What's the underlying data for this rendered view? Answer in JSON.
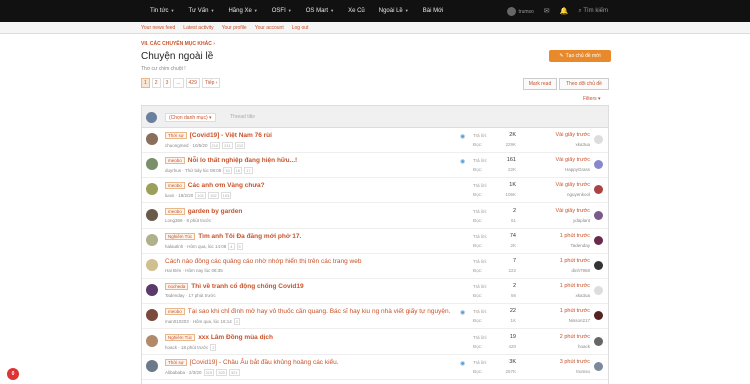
{
  "nav": {
    "items": [
      "Tin tức",
      "Tư Vấn",
      "Hãng Xe",
      "OSFI",
      "OS Mart",
      "Xe Cũ",
      "Ngoài Lề",
      "Bài Mới"
    ],
    "username": "trumso",
    "search_label": "Tìm kiếm"
  },
  "subnav": [
    "Your news feed",
    "Latest activity",
    "Your profile",
    "Your account",
    "Log out"
  ],
  "breadcrumb": "VII. CÁC CHUYÊN MỤC KHÁC",
  "page": {
    "title": "Chuyện ngoài lề",
    "subtitle": "Thơ cư chim chuột !",
    "new_thread_button": "Tạo chủ đề mới",
    "mark_read": "Mark read",
    "watch_forum": "Theo dõi chủ đề",
    "filters": "Filters"
  },
  "pager": [
    "1",
    "2",
    "3",
    "...",
    "429",
    "Tiếp"
  ],
  "new_thread": {
    "select_placeholder": "(Chọn danh mục)",
    "title_placeholder": "Thread title"
  },
  "threads": [
    {
      "prefix": "Thời sự",
      "title": "[Covid19] - Việt Nam 76 rùi",
      "meta": "chuongmed · 10/5/20",
      "pages": [
        "210",
        "211",
        "212"
      ],
      "replies": "2K",
      "views": "229K",
      "last_time": "Vài giây trước",
      "last_user": "xka3ua",
      "watched": true,
      "bold": true
    },
    {
      "prefix": "meobo",
      "title": "Nỗi lo thất nghiệp đang hiện hữu...!",
      "meta": "duyrhus · Thứ bảy lúc 08:05",
      "pages": [
        "15",
        "16",
        "17"
      ],
      "replies": "161",
      "views": "22K",
      "last_time": "Vài giây trước",
      "last_user": "HappyGrass",
      "watched": true,
      "bold": true
    },
    {
      "prefix": "meobo",
      "title": "Các anh ơm Vàng chưa?",
      "meta": "luoxi · 19/2/20",
      "pages": [
        "101",
        "102",
        "103"
      ],
      "replies": "1K",
      "views": "106K",
      "last_time": "Vài giây trước",
      "last_user": "nguyenkool",
      "watched": false,
      "bold": true
    },
    {
      "prefix": "meobo",
      "title": "garden by garden",
      "meta": "Long369 · 8 phút trước",
      "pages": [],
      "replies": "2",
      "views": "61",
      "last_time": "Vài giây trước",
      "last_user": "ydaplant",
      "watched": false,
      "bold": true
    },
    {
      "prefix": "Nghiêm Túc",
      "title": "Tìm anh Tôi Đa đăng mới phở 17.",
      "meta": "halautinh · Hôm qua, lúc 14:08",
      "pages": [
        "4",
        "5"
      ],
      "replies": "74",
      "views": "2K",
      "last_time": "1 phút trước",
      "last_user": "Tadenday",
      "watched": false,
      "bold": true
    },
    {
      "prefix": "",
      "title": "Cách nào đông các quảng cáo nhờ nhớp hiển thị trên các trang web",
      "meta": "Hai Đèn · Hôm nay lúc 08:35",
      "pages": [],
      "replies": "7",
      "views": "222",
      "last_time": "1 phút trước",
      "last_user": "dinh7968",
      "watched": false,
      "bold": false
    },
    {
      "prefix": "nocheda",
      "title": "Thì về tranh cổ động chống Covid19",
      "meta": "Tadenday · 17 phút trước",
      "pages": [],
      "replies": "2",
      "views": "56",
      "last_time": "1 phút trước",
      "last_user": "xka3ua",
      "watched": false,
      "bold": true
    },
    {
      "prefix": "meobo",
      "title": "Tại sao khi chỉ đình mở hay vô thuốc cần quang. Bác sĩ hay kiu ng nhà viết giấy tự nguyện.",
      "meta": "man010203 · Hôm qua, lúc 16:14",
      "pages": [
        "2"
      ],
      "replies": "22",
      "views": "1K",
      "last_time": "1 phút trước",
      "last_user": "Nisson217",
      "watched": true,
      "bold": false
    },
    {
      "prefix": "Nghiêm Túc",
      "title": "xxx Lâm Đồng mùa dịch",
      "meta": "hoack · 18 phút trước",
      "pages": [
        "2"
      ],
      "replies": "19",
      "views": "420",
      "last_time": "2 phút trước",
      "last_user": "hoack",
      "watched": false,
      "bold": true
    },
    {
      "prefix": "Thời sự",
      "title": "[Covid19] - Châu Âu bắt đầu khủng hoảng các kiểu.",
      "meta": "Alibababa · 2/3/20",
      "pages": [
        "319",
        "320",
        "321"
      ],
      "replies": "3K",
      "views": "257K",
      "last_time": "3 phút trước",
      "last_user": "trumso",
      "watched": true,
      "bold": false
    }
  ],
  "labels": {
    "replies": "Trả lời:",
    "views": "Đọc:"
  },
  "colors": {
    "accent": "#c8522a",
    "button": "#e88a2c"
  },
  "fab_text": "0"
}
